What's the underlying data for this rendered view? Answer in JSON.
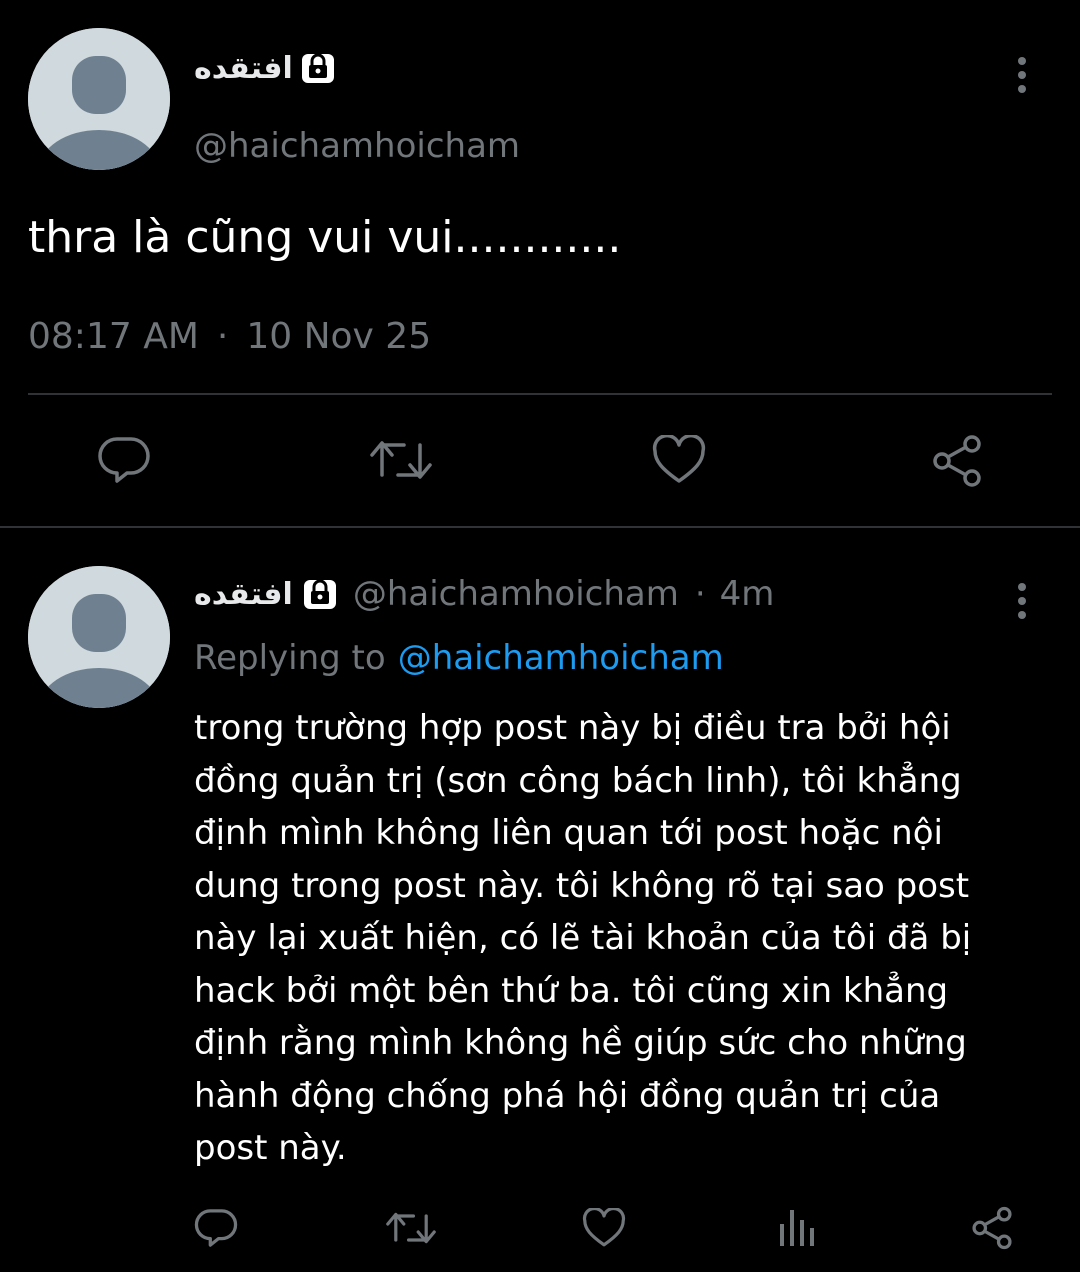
{
  "main_tweet": {
    "display_name": "افتقده",
    "handle": "@haichamhoicham",
    "text": "thra là cũng vui vui............",
    "time": "08:17 AM",
    "separator": "·",
    "date": "10 Nov 25"
  },
  "reply_tweet": {
    "display_name": "افتقده",
    "handle": "@haichamhoicham",
    "separator": "·",
    "age": "4m",
    "replying_prefix": "Replying to",
    "replying_handle": "@haichamhoicham",
    "text": "trong trường hợp post này bị điều tra bởi hội đồng quản trị (sơn công bách linh), tôi khẳng định mình không liên quan tới post hoặc nội dung trong post này. tôi không rõ tại sao post này lại xuất hiện, có lẽ tài khoản của tôi đã bị hack bởi một bên thứ ba. tôi cũng xin khẳng định rằng mình không hề giúp sức cho những hành động chống phá hội đồng quản trị của post này."
  },
  "icons": {
    "reply": "reply-icon",
    "retweet": "retweet-icon",
    "like": "like-icon",
    "share": "share-icon",
    "views": "views-icon",
    "more": "more-icon",
    "lock": "lock-icon"
  },
  "colors": {
    "background": "#000000",
    "text": "#ffffff",
    "muted": "#71767b",
    "link": "#1d9bf0",
    "avatar_bg": "#cfd9de",
    "avatar_fg": "#7a8a98"
  }
}
